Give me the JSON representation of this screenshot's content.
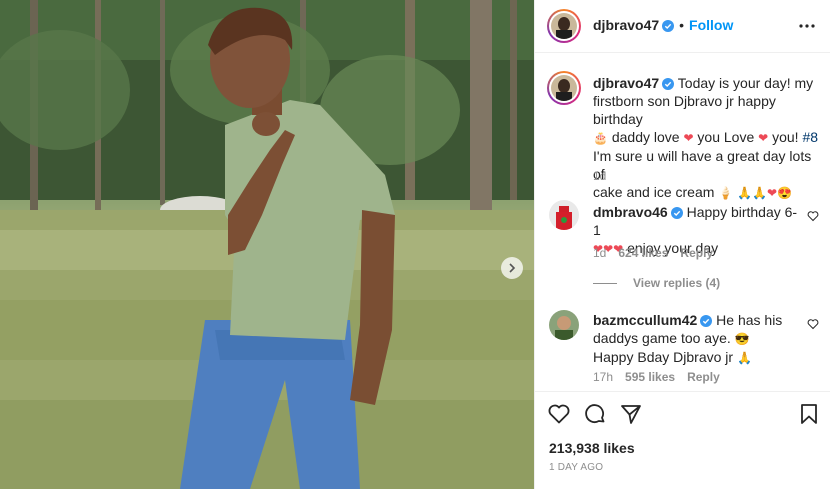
{
  "post": {
    "username": "djbravo47",
    "follow_label": "Follow",
    "separator": "•",
    "caption": {
      "line1": "Today is your day! my",
      "line2": "firstborn son Djbravo jr happy birthday",
      "line3a": "daddy love",
      "line3b": "you Love",
      "line3c": "you!",
      "hashtag": "#8",
      "line4": "I'm sure u will have a great day lots of",
      "line5": "cake and ice cream",
      "age": "1d"
    }
  },
  "comments": [
    {
      "username": "dmbravo46",
      "text1": "Happy birthday 6-1",
      "text2": "enjoy your day",
      "age": "1d",
      "likes": "624 likes",
      "reply_label": "Reply",
      "view_replies": "View replies (4)"
    },
    {
      "username": "bazmccullum42",
      "text1": "He has his",
      "text2": "daddys game too aye.",
      "text3": "Happy Bday Djbravo jr",
      "age": "17h",
      "likes": "595 likes",
      "reply_label": "Reply"
    }
  ],
  "footer": {
    "likes": "213,938 likes",
    "posted": "1 DAY AGO"
  },
  "icons": {
    "like": "heart-outline-icon",
    "comment": "comment-bubble-icon",
    "share": "paper-plane-icon",
    "save": "bookmark-icon",
    "more": "ellipsis-icon",
    "verified": "verified-badge-icon",
    "next": "chevron-right-icon"
  },
  "colors": {
    "accent": "#0095f6",
    "verified": "#3897f0",
    "text": "#262626",
    "muted": "#8e8e8e",
    "heart": "#ed4956"
  }
}
